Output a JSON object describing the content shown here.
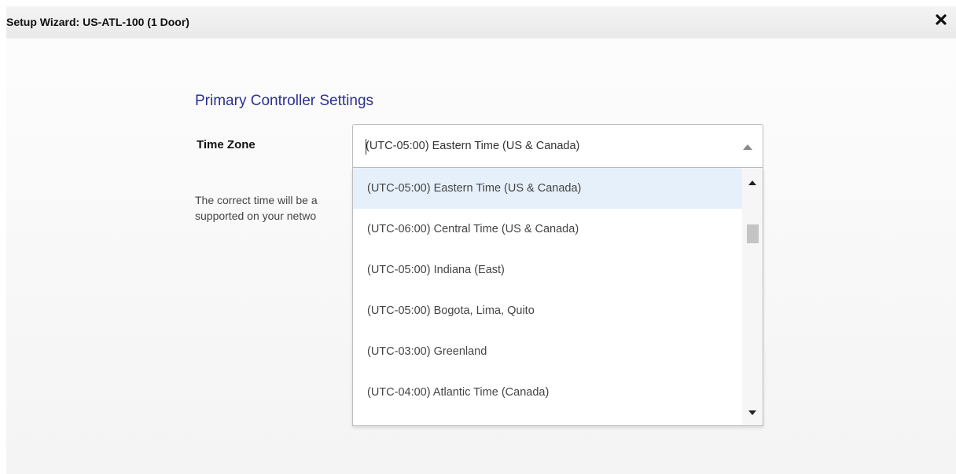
{
  "dialog": {
    "title": "Setup Wizard: US-ATL-100 (1 Door)",
    "close_icon": "close-icon"
  },
  "section": {
    "heading": "Primary Controller Settings"
  },
  "time_zone": {
    "label": "Time Zone",
    "selected_value": "(UTC-05:00) Eastern Time (US & Canada)",
    "help_text_line1": "The correct time will be a",
    "help_text_line2": "supported on your netwo",
    "options": [
      "(UTC-05:00) Eastern Time (US & Canada)",
      "(UTC-06:00) Central Time (US & Canada)",
      "(UTC-05:00) Indiana (East)",
      "(UTC-05:00) Bogota, Lima, Quito",
      "(UTC-03:00) Greenland",
      "(UTC-04:00) Atlantic Time (Canada)"
    ]
  },
  "colors": {
    "heading": "#2b2f91",
    "selected_option_bg": "#e6f0fb"
  }
}
